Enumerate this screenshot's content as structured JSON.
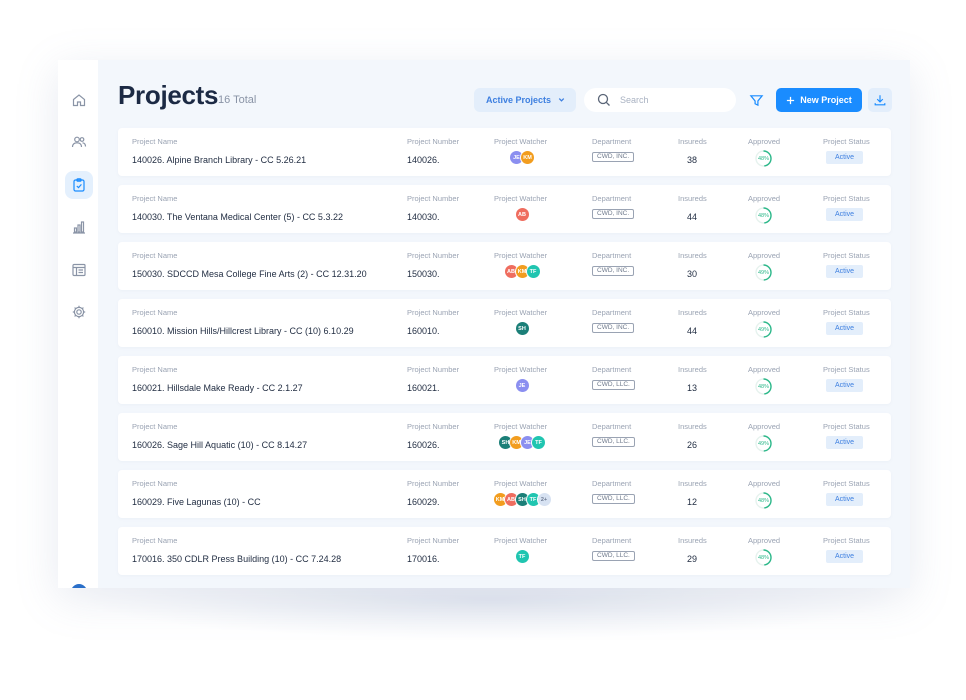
{
  "header": {
    "title": "Projects",
    "total": "16 Total",
    "filter_label": "Active Projects",
    "search_placeholder": "Search",
    "new_button": "New Project"
  },
  "columns": {
    "name": "Project Name",
    "number": "Project Number",
    "watcher": "Project Watcher",
    "department": "Department",
    "insureds": "Insureds",
    "approved": "Approved",
    "status": "Project Status"
  },
  "rows": [
    {
      "name": "140026. Alpine Branch Library - CC 5.26.21",
      "number": "140026.",
      "watchers": [
        {
          "initials": "JE",
          "color": "#8b8ff0"
        },
        {
          "initials": "KM",
          "color": "#f29d1f"
        }
      ],
      "department": "CWD, INC.",
      "insureds": "38",
      "approved": "48%",
      "approved_value": 48,
      "status": "Active"
    },
    {
      "name": "140030. The Ventana Medical Center (5) - CC 5.3.22",
      "number": "140030.",
      "watchers": [
        {
          "initials": "AB",
          "color": "#ef6d5f"
        }
      ],
      "department": "CWD, INC.",
      "insureds": "44",
      "approved": "48%",
      "approved_value": 48,
      "status": "Active"
    },
    {
      "name": "150030.  SDCCD Mesa College Fine Arts  (2) - CC 12.31.20",
      "number": "150030.",
      "watchers": [
        {
          "initials": "AB",
          "color": "#ef6d5f"
        },
        {
          "initials": "KM",
          "color": "#f29d1f"
        },
        {
          "initials": "TF",
          "color": "#20c5b0"
        }
      ],
      "department": "CWD, INC.",
      "insureds": "30",
      "approved": "49%",
      "approved_value": 49,
      "status": "Active"
    },
    {
      "name": "160010. Mission Hills/Hillcrest Library - CC (10) 6.10.29",
      "number": "160010.",
      "watchers": [
        {
          "initials": "SH",
          "color": "#1b7f78"
        }
      ],
      "department": "CWD, INC.",
      "insureds": "44",
      "approved": "49%",
      "approved_value": 49,
      "status": "Active"
    },
    {
      "name": "160021. Hillsdale Make Ready - CC 2.1.27",
      "number": "160021.",
      "watchers": [
        {
          "initials": "JE",
          "color": "#8b8ff0"
        }
      ],
      "department": "CWD, LLC.",
      "insureds": "13",
      "approved": "48%",
      "approved_value": 48,
      "status": "Active"
    },
    {
      "name": "160026. Sage Hill Aquatic (10) - CC 8.14.27",
      "number": "160026.",
      "watchers": [
        {
          "initials": "SH",
          "color": "#1b7f78"
        },
        {
          "initials": "KM",
          "color": "#f29d1f"
        },
        {
          "initials": "JE",
          "color": "#8b8ff0"
        },
        {
          "initials": "TF",
          "color": "#20c5b0"
        }
      ],
      "department": "CWD, LLC.",
      "insureds": "26",
      "approved": "49%",
      "approved_value": 49,
      "status": "Active"
    },
    {
      "name": "160029. Five Lagunas (10) - CC",
      "number": "160029.",
      "watchers": [
        {
          "initials": "KM",
          "color": "#f29d1f"
        },
        {
          "initials": "AB",
          "color": "#ef6d5f"
        },
        {
          "initials": "SH",
          "color": "#1b7f78"
        },
        {
          "initials": "TF",
          "color": "#20c5b0"
        },
        {
          "initials": "2+",
          "color": "#d7e2f2",
          "text": "#6b7890"
        }
      ],
      "department": "CWD, LLC.",
      "insureds": "12",
      "approved": "48%",
      "approved_value": 48,
      "status": "Active"
    },
    {
      "name": "170016.  350 CDLR Press Building (10) - CC 7.24.28",
      "number": "170016.",
      "watchers": [
        {
          "initials": "TF",
          "color": "#20c5b0"
        }
      ],
      "department": "CWD, LLC.",
      "insureds": "29",
      "approved": "48%",
      "approved_value": 48,
      "status": "Active"
    }
  ],
  "colors": {
    "accent": "#1a8cff",
    "ring": "#2db88a",
    "title": "#1c2a44"
  },
  "icons": [
    "home-icon",
    "users-icon",
    "clipboard-check-icon",
    "bar-chart-icon",
    "list-icon",
    "gear-icon",
    "search-icon",
    "filter-icon",
    "plus-icon",
    "download-icon",
    "chevron-down-icon"
  ]
}
